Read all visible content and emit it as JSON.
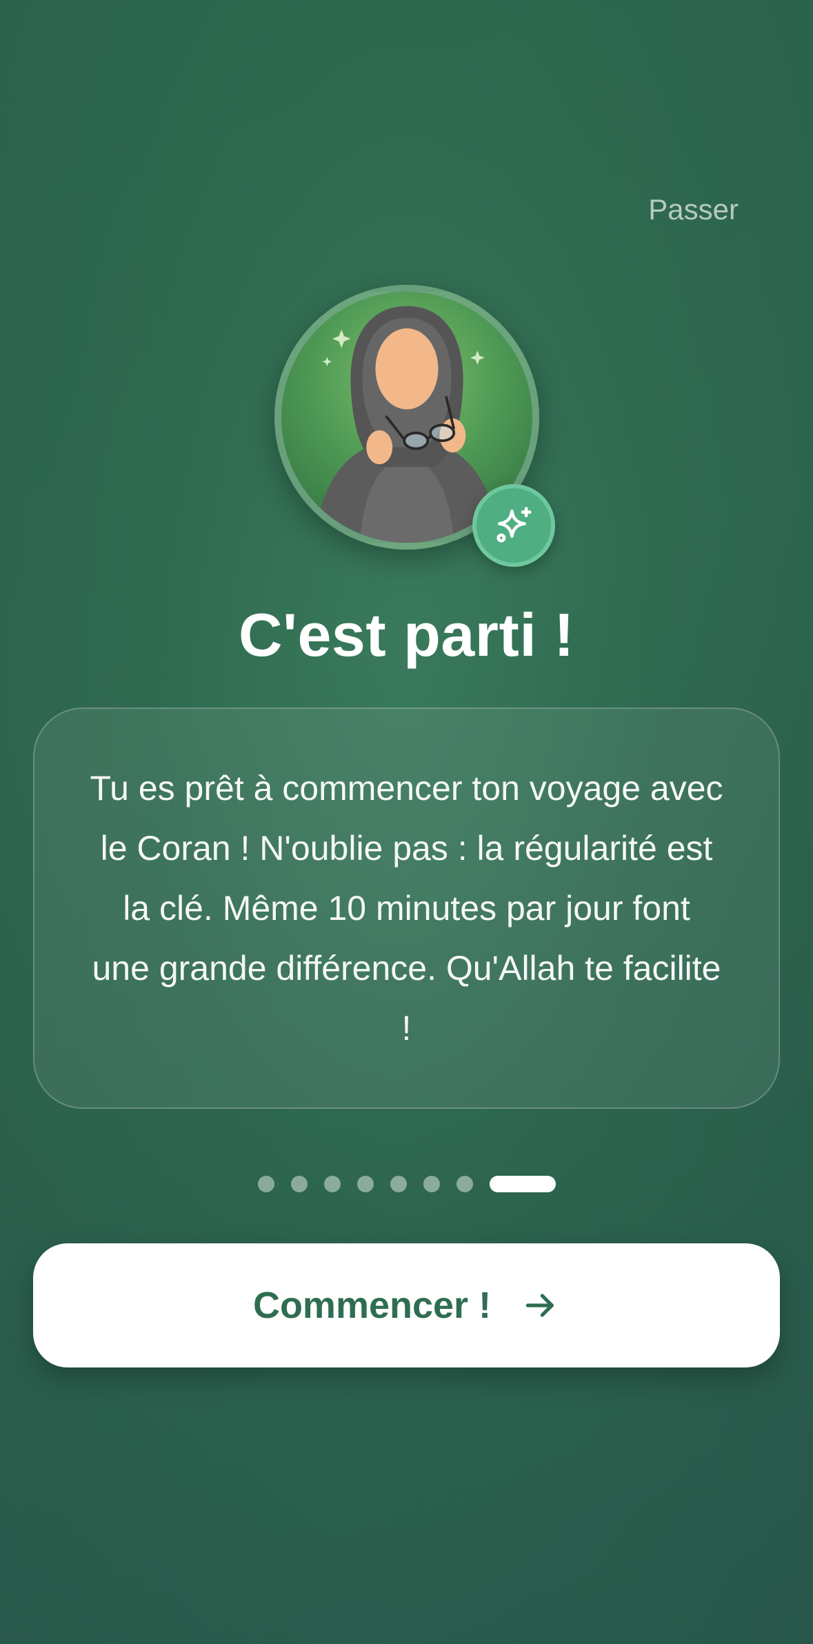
{
  "header": {
    "skip_label": "Passer"
  },
  "avatar": {
    "icon": "woman-in-hijab-holding-glasses-icon",
    "badge_icon": "sparkles-icon"
  },
  "title": "C'est parti !",
  "message": "Tu es prêt à commencer ton voyage avec le Coran ! N'oublie pas : la régularité est la clé. Même 10 minutes par jour font une grande différence. Qu'Allah te facilite !",
  "pager": {
    "total_steps": 8,
    "current_step": 8
  },
  "cta": {
    "label": "Commencer !",
    "icon": "arrow-right-icon"
  },
  "colors": {
    "background": "#2f6a50",
    "accent": "#4fae82",
    "button_text": "#2f6d52"
  }
}
